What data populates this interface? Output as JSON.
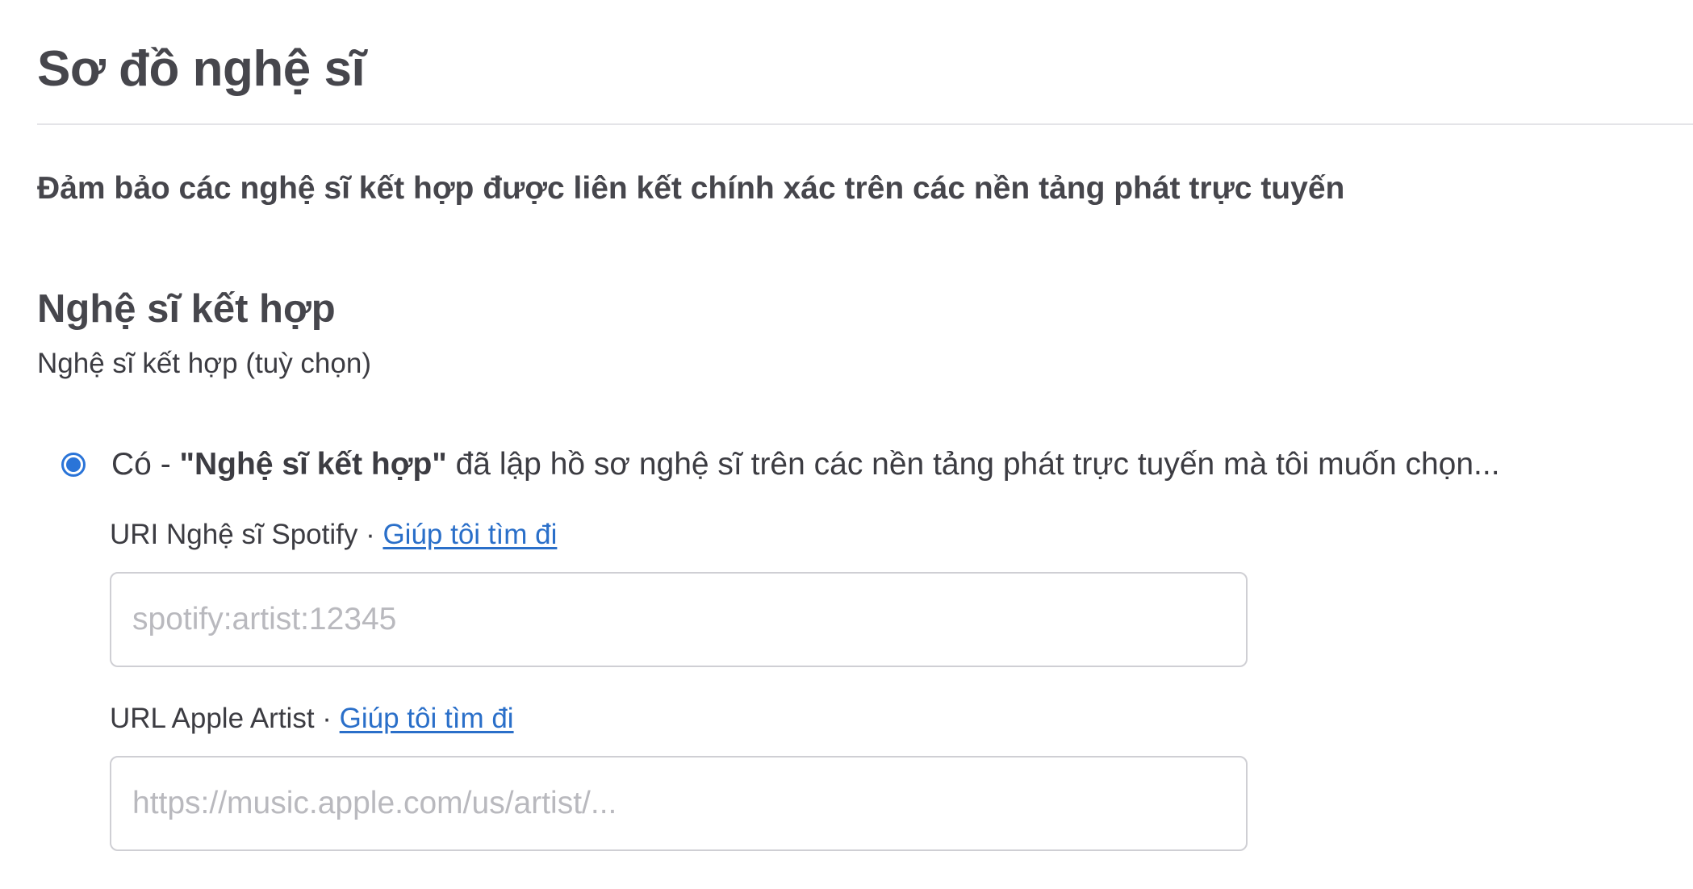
{
  "page": {
    "title": "Sơ đồ nghệ sĩ",
    "subtitle": "Đảm bảo các nghệ sĩ kết hợp được liên kết chính xác trên các nền tảng phát trực tuyến"
  },
  "featured_artist": {
    "section_title": "Nghệ sĩ kết hợp",
    "hint": "Nghệ sĩ kết hợp (tuỳ chọn)",
    "option_yes": {
      "prefix": "Có - ",
      "bold": "\"Nghệ sĩ kết hợp\"",
      "suffix": " đã lập hồ sơ nghệ sĩ trên các nền tảng phát trực tuyến mà tôi muốn chọn...",
      "selected": true
    },
    "spotify": {
      "label": "URI Nghệ sĩ Spotify",
      "separator": " · ",
      "help_link": "Giúp tôi tìm đi",
      "value": "",
      "placeholder": "spotify:artist:12345"
    },
    "apple": {
      "label": "URL Apple Artist",
      "separator": " · ",
      "help_link": "Giúp tôi tìm đi",
      "value": "",
      "placeholder": "https://music.apple.com/us/artist/..."
    }
  },
  "colors": {
    "accent": "#2a74d8",
    "link": "#2a6fc9",
    "text": "#3c3c42",
    "border": "#cfcfd4"
  }
}
